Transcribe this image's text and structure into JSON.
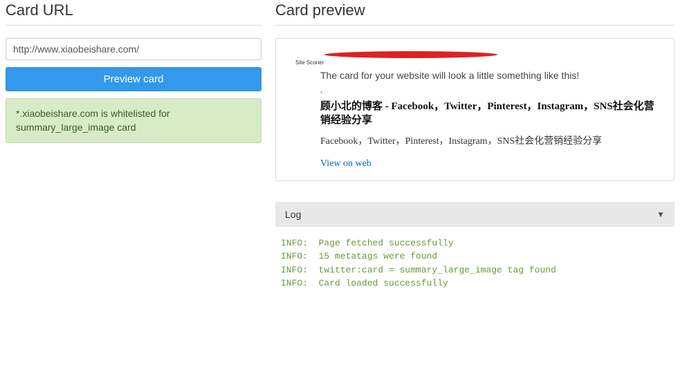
{
  "left": {
    "heading": "Card URL",
    "url_value": "http://www.xiaobeishare.com/",
    "button_label": "Preview card",
    "alert_text": "*.xiaobeishare.com is whitelisted for summary_large_image card"
  },
  "preview": {
    "heading": "Card preview",
    "site_bar": "Site Scorier",
    "intro": "The card for your website will look a little something like this!",
    "tiny": "•",
    "card_title": "顾小北的博客 - Facebook，Twitter，Pinterest，Instagram，SNS社会化营销经验分享",
    "card_meta": "Facebook，Twitter，Pinterest，Instagram，SNS社会化营销经验分享",
    "view_link": "View on web"
  },
  "log": {
    "header": "Log",
    "lines": [
      "INFO:  Page fetched successfully",
      "INFO:  15 metatags were found",
      "INFO:  twitter:card = summary_large_image tag found",
      "INFO:  Card loaded successfully"
    ]
  }
}
